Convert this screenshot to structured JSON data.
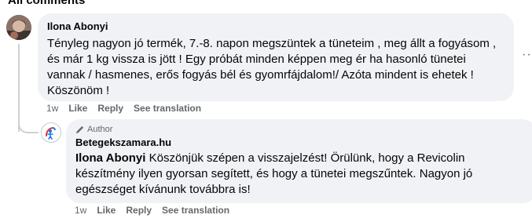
{
  "section_title": "All comments",
  "comments": [
    {
      "author": "Ilona Abonyi",
      "text": "Tényleg nagyon jó termék, 7.-8. napon megszüntek a tüneteim , meg állt a fogyásom , és már 1 kg vissza is jött ! Egy próbát minden képpen meg ér ha hasonló tünetei vannak / hasmenes, erős fogyás bél és gyomrfájdalom!/ Azóta mindent is ehetek ! Köszönöm !",
      "time": "1w",
      "actions": {
        "like": "Like",
        "reply": "Reply",
        "translate": "See translation"
      },
      "more_icon": "more-dots",
      "reply": {
        "badge": "Author",
        "author": "Betegekszamara.hu",
        "mention": "Ilona Abonyi",
        "text": "Köszönjük szépen a visszajelzést! Örülünk, hogy a Revicolin készítmény ilyen gyorsan segített, és hogy a tünetei megszűntek. Nagyon jó egészséget kívánunk továbbra is!",
        "time": "1w",
        "actions": {
          "like": "Like",
          "reply": "Reply",
          "translate": "See translation"
        }
      }
    }
  ],
  "colors": {
    "bubble": "#f0f2f5",
    "text": "#050505",
    "secondary": "#65676b",
    "thread": "#ced0d4",
    "brand": "#1877f2"
  }
}
